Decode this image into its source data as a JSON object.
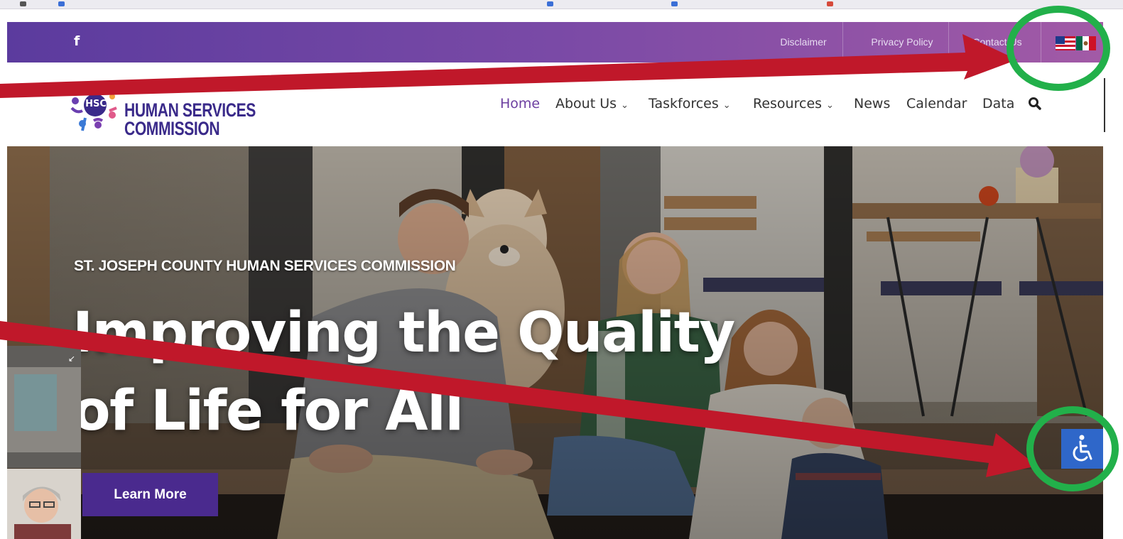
{
  "topbar": {
    "social_icon": "facebook-icon",
    "facebook_glyph": "f",
    "links": [
      "Disclaimer",
      "Privacy Policy",
      "Contact Us"
    ],
    "language_icon": "us-mexico-flag-icon"
  },
  "header": {
    "logo_badge": "HSC",
    "logo_line1": "HUMAN SERVICES",
    "logo_line2": "COMMISSION",
    "nav": {
      "home": "Home",
      "about": "About Us",
      "taskforces": "Taskforces",
      "resources": "Resources",
      "news": "News",
      "calendar": "Calendar",
      "data": "Data"
    },
    "search_icon": "search-icon"
  },
  "hero": {
    "eyebrow": "ST. JOSEPH COUNTY HUMAN SERVICES COMMISSION",
    "headline_line1": "Improving the Quality",
    "headline_line2": "of Life for All",
    "cta_label": "Learn More",
    "accessibility_icon": "wheelchair-accessibility-icon"
  },
  "colors": {
    "topbar_start": "#5b3b9e",
    "topbar_end": "#a25aa6",
    "brand_purple": "#4a2a8e",
    "nav_active": "#6c3fa0",
    "accessibility_blue": "#2f67c9",
    "annotation_red": "#c0182a",
    "annotation_green": "#22b04a"
  }
}
